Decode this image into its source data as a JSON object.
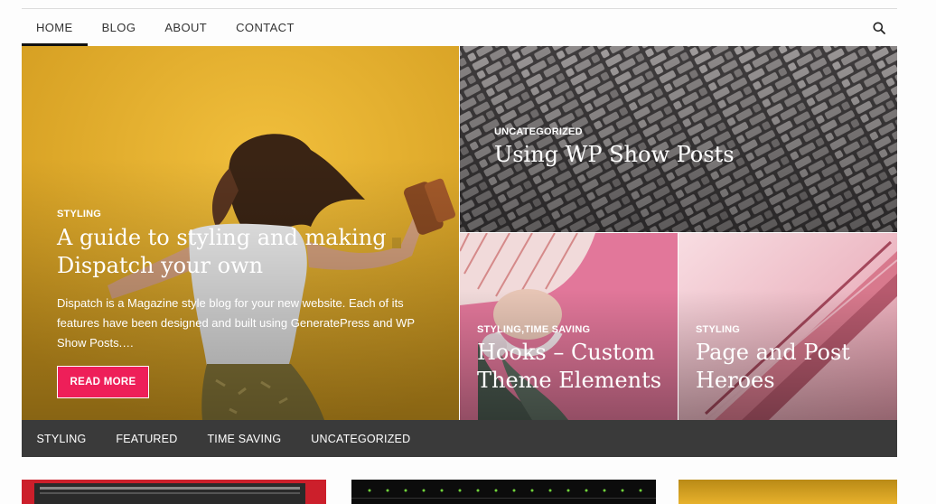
{
  "nav": {
    "items": [
      {
        "label": "HOME",
        "active": true
      },
      {
        "label": "BLOG",
        "active": false
      },
      {
        "label": "ABOUT",
        "active": false
      },
      {
        "label": "CONTACT",
        "active": false
      }
    ],
    "search_icon": "search-icon"
  },
  "hero": {
    "main": {
      "category": "STYLING",
      "title": "A guide to styling and making Dispatch your own",
      "excerpt": "Dispatch is a Magazine style blog for your new website. Each of its features have been designed and built using GeneratePress and WP Show Posts.…",
      "button": "READ MORE"
    },
    "top_right": {
      "category": "UNCATEGORIZED",
      "title": "Using WP Show Posts"
    },
    "bottom_left": {
      "category": "STYLING,TIME SAVING",
      "title": "Hooks – Custom Theme Elements"
    },
    "bottom_right": {
      "category": "STYLING",
      "title": "Page and Post Heroes"
    }
  },
  "category_bar": [
    "STYLING",
    "FEATURED",
    "TIME SAVING",
    "UNCATEGORIZED"
  ],
  "colors": {
    "accent": "#ee1f59",
    "category_bar_bg": "#3a3a3a",
    "main_bg": "#e1a928"
  }
}
